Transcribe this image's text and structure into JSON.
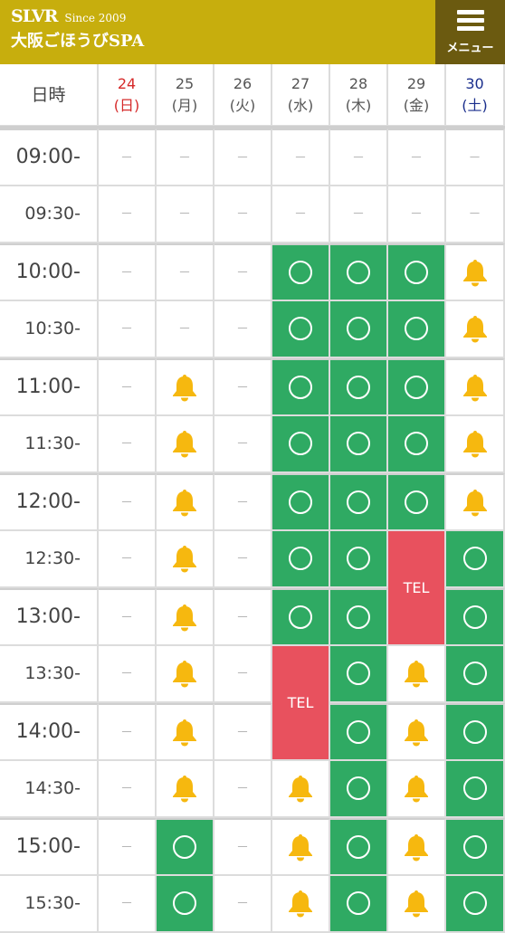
{
  "header": {
    "brand": "SLVR",
    "since": "Since 2009",
    "shop_name": "大阪ごほうびSPA",
    "menu_label": "メニュー"
  },
  "table": {
    "corner_label": "日時",
    "days": [
      {
        "date": "24",
        "weekday": "(日)",
        "color": "#d62b2b"
      },
      {
        "date": "25",
        "weekday": "(月)",
        "color": "#555555"
      },
      {
        "date": "26",
        "weekday": "(火)",
        "color": "#555555"
      },
      {
        "date": "27",
        "weekday": "(水)",
        "color": "#555555"
      },
      {
        "date": "28",
        "weekday": "(木)",
        "color": "#555555"
      },
      {
        "date": "29",
        "weekday": "(金)",
        "color": "#555555"
      },
      {
        "date": "30",
        "weekday": "(土)",
        "color": "#1a2e8c"
      }
    ],
    "legend": {
      "available": "○ available",
      "request": "bell icon",
      "tel": "TEL",
      "closed": "－"
    },
    "tel_label": "TEL",
    "dash_label": "－",
    "rows": [
      {
        "time": "09:00-",
        "cells": [
          "-",
          "-",
          "-",
          "-",
          "-",
          "-",
          "-"
        ]
      },
      {
        "time": "09:30-",
        "cells": [
          "-",
          "-",
          "-",
          "-",
          "-",
          "-",
          "-"
        ]
      },
      {
        "time": "10:00-",
        "cells": [
          "-",
          "-",
          "-",
          "o",
          "o",
          "o",
          "b"
        ]
      },
      {
        "time": "10:30-",
        "cells": [
          "-",
          "-",
          "-",
          "o",
          "o",
          "o",
          "b"
        ]
      },
      {
        "time": "11:00-",
        "cells": [
          "-",
          "b",
          "-",
          "o",
          "o",
          "o",
          "b"
        ]
      },
      {
        "time": "11:30-",
        "cells": [
          "-",
          "b",
          "-",
          "o",
          "o",
          "o",
          "b"
        ]
      },
      {
        "time": "12:00-",
        "cells": [
          "-",
          "b",
          "-",
          "o",
          "o",
          "o",
          "b"
        ]
      },
      {
        "time": "12:30-",
        "cells": [
          "-",
          "b",
          "-",
          "o",
          "o",
          "TEL",
          "o"
        ]
      },
      {
        "time": "13:00-",
        "cells": [
          "-",
          "b",
          "-",
          "o",
          "o",
          "TEL",
          "o"
        ]
      },
      {
        "time": "13:30-",
        "cells": [
          "-",
          "b",
          "-",
          "TEL",
          "o",
          "b",
          "o"
        ]
      },
      {
        "time": "14:00-",
        "cells": [
          "-",
          "b",
          "-",
          "TEL",
          "o",
          "b",
          "o"
        ]
      },
      {
        "time": "14:30-",
        "cells": [
          "-",
          "b",
          "-",
          "b",
          "o",
          "b",
          "o"
        ]
      },
      {
        "time": "15:00-",
        "cells": [
          "-",
          "o",
          "-",
          "b",
          "o",
          "b",
          "o"
        ]
      },
      {
        "time": "15:30-",
        "cells": [
          "-",
          "o",
          "-",
          "b",
          "o",
          "b",
          "o"
        ]
      }
    ],
    "colors": {
      "available": "#2faa63",
      "tel": "#e8515e",
      "bell": "#f6b80f",
      "header_bar": "#c7ae0d",
      "menu_button": "#6b5a10"
    }
  }
}
